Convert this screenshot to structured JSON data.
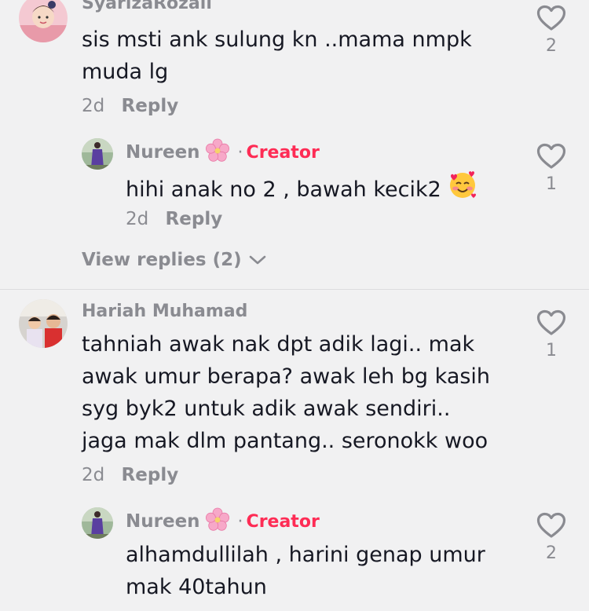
{
  "comments": [
    {
      "username": "SyarizaRozali",
      "text": "sis msti ank sulung kn ..mama nmpk muda lg",
      "time": "2d",
      "reply_label": "Reply",
      "likes": "2",
      "like_icon": "heart-outline-icon",
      "replies": [
        {
          "username": "Nureen",
          "name_emoji": "cherry-blossom",
          "badge": "Creator",
          "text": "hihi anak no 2 , bawah kecik2",
          "text_emoji": "smiling-face-with-hearts",
          "time": "2d",
          "reply_label": "Reply",
          "likes": "1"
        }
      ],
      "view_replies": "View replies (2)"
    },
    {
      "username": "Hariah Muhamad",
      "text": "tahniah awak nak dpt adik lagi.. mak awak umur berapa? awak leh bg kasih syg byk2 untuk adik awak sendiri.. jaga mak dlm pantang.. seronokk woo",
      "time": "2d",
      "reply_label": "Reply",
      "likes": "1",
      "replies": [
        {
          "username": "Nureen",
          "name_emoji": "cherry-blossom",
          "badge": "Creator",
          "separator": "·",
          "text": "alhamdullilah , harini genap umur mak 40tahun",
          "likes": "2"
        }
      ]
    }
  ],
  "colors": {
    "background": "#f1f1f2",
    "text": "#161823",
    "muted": "#8a8b91",
    "creator": "#fe2c55"
  }
}
